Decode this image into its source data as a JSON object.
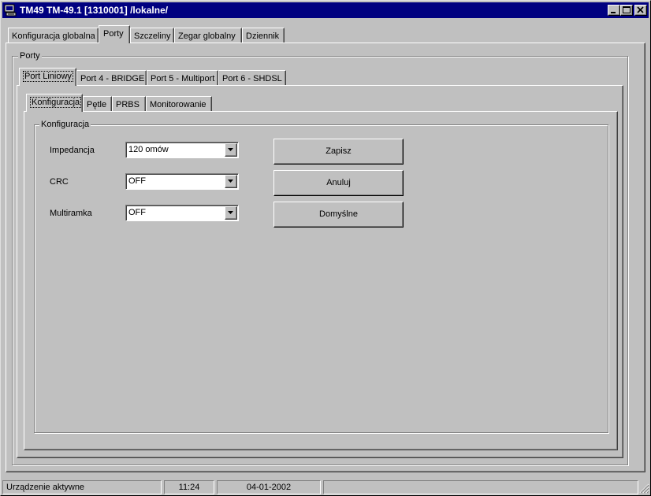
{
  "window": {
    "title": "TM49 TM-49.1 [1310001] /lokalne/",
    "controls": {
      "minimize_icon": "minimize-icon",
      "maximize_icon": "maximize-icon",
      "close_icon": "close-icon"
    }
  },
  "main_tabs": [
    {
      "label": "Konfiguracja globalna",
      "active": false
    },
    {
      "label": "Porty",
      "active": true
    },
    {
      "label": "Szczeliny",
      "active": false
    },
    {
      "label": "Zegar globalny",
      "active": false
    },
    {
      "label": "Dziennik",
      "active": false
    }
  ],
  "ports_group": {
    "label": "Porty"
  },
  "port_tabs": [
    {
      "label": "Port Liniowy",
      "active": true
    },
    {
      "label": "Port 4 - BRIDGE",
      "active": false
    },
    {
      "label": "Port 5 - Multiport",
      "active": false
    },
    {
      "label": "Port 6 - SHDSL",
      "active": false
    }
  ],
  "sub_tabs": [
    {
      "label": "Konfiguracja",
      "active": true
    },
    {
      "label": "Pętle",
      "active": false
    },
    {
      "label": "PRBS",
      "active": false
    },
    {
      "label": "Monitorowanie",
      "active": false
    }
  ],
  "config_group": {
    "label": "Konfiguracja"
  },
  "fields": [
    {
      "label": "Impedancja",
      "value": "120 omów"
    },
    {
      "label": "CRC",
      "value": "OFF"
    },
    {
      "label": "Multiramka",
      "value": "OFF"
    }
  ],
  "buttons": {
    "save": "Zapisz",
    "cancel": "Anuluj",
    "defaults": "Domyślne"
  },
  "status_bar": {
    "status": "Urządzenie aktywne",
    "time": "11:24",
    "date": "04-01-2002"
  }
}
